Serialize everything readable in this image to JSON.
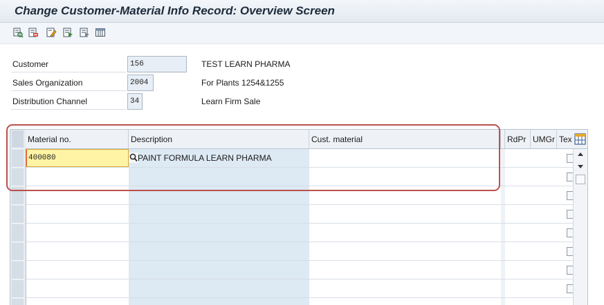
{
  "window": {
    "title": "Change Customer-Material Info Record: Overview Screen"
  },
  "toolbar": {
    "buttons": [
      {
        "icon": "details-icon"
      },
      {
        "icon": "delete-row-icon"
      },
      {
        "icon": "edit-icon"
      },
      {
        "icon": "texts-icon"
      },
      {
        "icon": "select-block-icon"
      },
      {
        "icon": "table-settings-icon"
      }
    ]
  },
  "header": {
    "customer": {
      "label": "Customer",
      "value": "156",
      "description": "TEST LEARN PHARMA"
    },
    "sales_org": {
      "label": "Sales Organization",
      "value": "2004",
      "description": "For Plants 1254&1255"
    },
    "dist_channel": {
      "label": "Distribution Channel",
      "value": "34",
      "description": "Learn Firm Sale"
    }
  },
  "table": {
    "columns": {
      "material": "Material no.",
      "description": "Description",
      "cust_material": "Cust. material",
      "rdpr": "RdPr",
      "umgr": "UMGr",
      "text": "Tex"
    },
    "rows": [
      {
        "material": "400080",
        "description": "PAINT FORMULA LEARN PHARMA",
        "cust_material": ""
      }
    ]
  },
  "colors": {
    "title_bar": "#e3e9f1",
    "input_highlight": "#fff4a5",
    "description_column": "#dde9f3",
    "annotation_box": "#b9504c"
  }
}
